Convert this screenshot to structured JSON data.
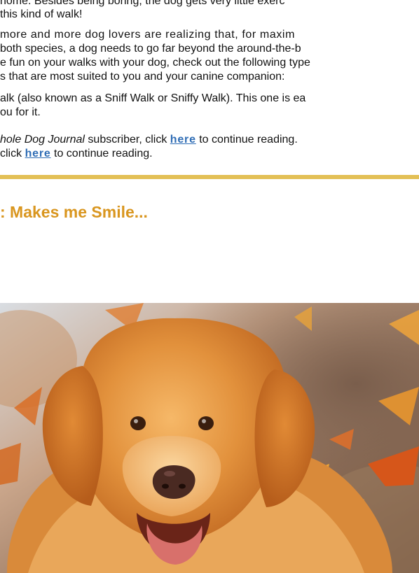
{
  "article": {
    "para1": {
      "line1": "home. Besides being boring, the dog gets very little exerc",
      "line2": "this kind of walk!"
    },
    "para2": {
      "line1": "more and more dog lovers are realizing that, for maxim",
      "line2": "both species, a dog needs to go far beyond the around-the-b",
      "line3": "e fun on your walks with your dog, check out the following type",
      "line4": "s that are most suited to you and your canine companion:"
    },
    "para3": {
      "line1": "alk (also known as a Sniff Walk or Sniffy Walk). This one is ea",
      "line2": "ou for it."
    },
    "para4": {
      "line1_prefix": "hole Dog Journal",
      "line1_middle": " subscriber, click ",
      "line1_link": "here",
      "line1_suffix": " to continue reading.",
      "line2_prefix": " click ",
      "line2_link": "here",
      "line2_suffix": " to continue reading."
    }
  },
  "section": {
    "title": ": Makes me Smile..."
  },
  "colors": {
    "divider": "#e3c056",
    "section_title": "#d9961f",
    "link": "#2f6db5"
  }
}
